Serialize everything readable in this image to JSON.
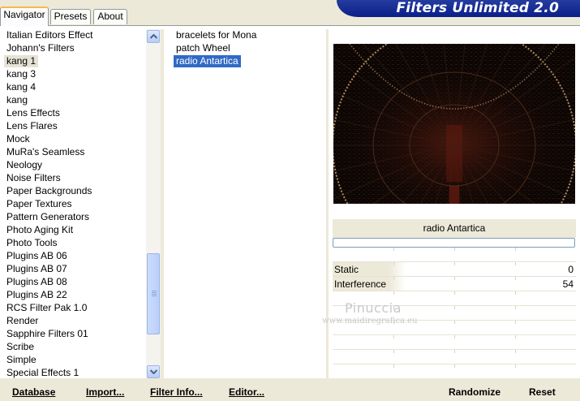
{
  "tabs": [
    {
      "label": "Navigator"
    },
    {
      "label": "Presets"
    },
    {
      "label": "About"
    }
  ],
  "banner": {
    "title": "Filters Unlimited 2.0"
  },
  "categories": [
    "Italian Editors Effect",
    "Johann's Filters",
    "kang 1",
    "kang 3",
    "kang 4",
    "kang",
    "Lens Effects",
    "Lens Flares",
    "Mock",
    "MuRa's Seamless",
    "Neology",
    "Noise Filters",
    "Paper Backgrounds",
    "Paper Textures",
    "Pattern Generators",
    "Photo Aging Kit",
    "Photo Tools",
    "Plugins AB 06",
    "Plugins AB 07",
    "Plugins AB 08",
    "Plugins AB 22",
    "RCS Filter Pak 1.0",
    "Render",
    "Sapphire Filters 01",
    "Scribe",
    "Simple",
    "Special Effects 1"
  ],
  "selected_category": "kang 1",
  "filters": [
    "bracelets for Mona",
    "patch Wheel",
    "radio Antartica"
  ],
  "selected_filter": "radio Antartica",
  "preview": {
    "filter_name": "radio Antartica"
  },
  "params": [
    {
      "label": "Static",
      "value": "0"
    },
    {
      "label": "Interference",
      "value": "54"
    }
  ],
  "watermark": {
    "name": "Pinuccia",
    "url": "www.maidiregrafica.eu"
  },
  "buttons": {
    "database": "Database",
    "import": "Import...",
    "filter_info": "Filter Info...",
    "editor": "Editor...",
    "randomize": "Randomize",
    "reset": "Reset"
  },
  "icons": {
    "scroll_up": "chevron-up-icon",
    "scroll_down": "chevron-down-icon"
  },
  "colors": {
    "banner": "#0b1f88",
    "selection": "#316ac5",
    "preview_bg": "#0b0604"
  }
}
